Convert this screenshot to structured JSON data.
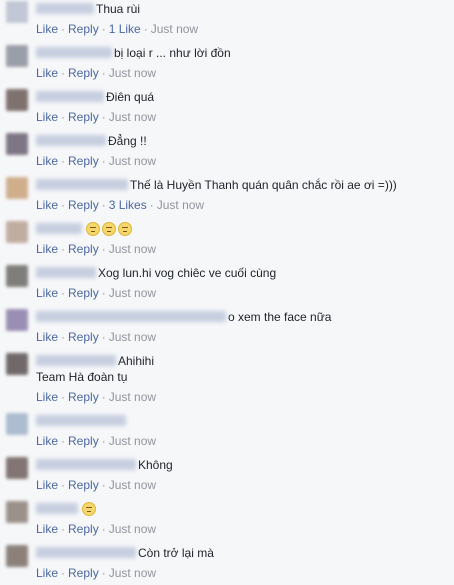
{
  "actions": {
    "like": "Like",
    "reply": "Reply",
    "sep": "·"
  },
  "comments": [
    {
      "text": "Thua rùi",
      "likes": "1 Like",
      "time": "Just now",
      "avatar_color": "#b9bfd0"
    },
    {
      "text": "bị loại r ... như lời đồn",
      "likes": "",
      "time": "Just now",
      "avatar_color": "#8a8f9a"
    },
    {
      "text": "Điên quá",
      "likes": "",
      "time": "Just now",
      "avatar_color": "#6b5a56"
    },
    {
      "text": "Đẳng !!",
      "likes": "",
      "time": "Just now",
      "avatar_color": "#6a6070"
    },
    {
      "text": "Thế là Huyền Thanh quán quân chắc rồi ae ơi =)))",
      "likes": "3 Likes",
      "time": "Just now",
      "avatar_color": "#c9a27a"
    },
    {
      "text": "",
      "emoji_count": 3,
      "likes": "",
      "time": "Just now",
      "avatar_color": "#b7a091"
    },
    {
      "text": "Xog lun.hi vog chiêc ve cuối cùng",
      "likes": "",
      "time": "Just now",
      "avatar_color": "#6c6a64"
    },
    {
      "text": "o xem the face nữa",
      "likes": "",
      "time": "Just now",
      "avatar_color": "#8a7ca8"
    },
    {
      "text": "Ahihihi",
      "text2": "Team Hà đoàn tụ",
      "likes": "",
      "time": "Just now",
      "avatar_color": "#5a5150"
    },
    {
      "text": "",
      "likes": "",
      "time": "Just now",
      "avatar_color": "#9fb3c8"
    },
    {
      "text": "Không",
      "likes": "",
      "time": "Just now",
      "avatar_color": "#6e5f5c"
    },
    {
      "text": "",
      "emoji_count": 1,
      "likes": "",
      "time": "Just now",
      "avatar_color": "#8c8078"
    },
    {
      "text": "Còn trở lại mà",
      "likes": "",
      "time": "Just now",
      "avatar_color": "#7a6c66"
    }
  ]
}
